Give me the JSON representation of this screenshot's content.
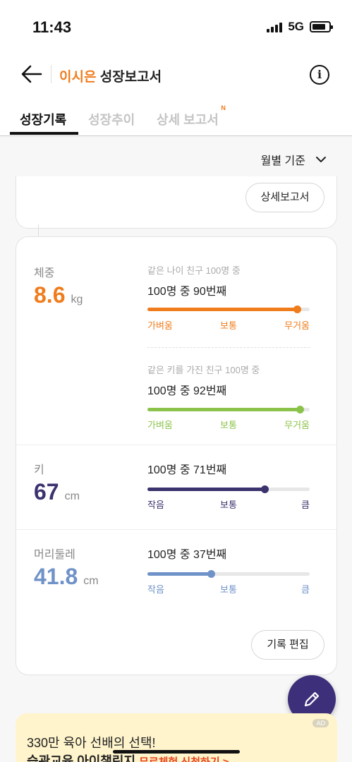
{
  "status_bar": {
    "time": "11:43",
    "network": "5G"
  },
  "header": {
    "child_name": "이시은",
    "title_rest": "성장보고서",
    "info_icon": "info-icon",
    "back_icon": "back-arrow-icon"
  },
  "tabs": [
    {
      "label": "성장기록",
      "active": true
    },
    {
      "label": "성장추이",
      "active": false
    },
    {
      "label": "상세 보고서",
      "active": false,
      "badge": "N"
    }
  ],
  "sort": {
    "label": "월별 기준"
  },
  "report_button": "상세보고서",
  "weight": {
    "label": "체중",
    "value": "8.6",
    "unit": "kg",
    "color": "#f07c1c",
    "age_comparison": {
      "caption": "같은 나이 친구 100명 중",
      "rank": "100명 중 90번째",
      "percentile": 0.92,
      "color": "#f07c1c",
      "scale": [
        "가벼움",
        "보통",
        "무거움"
      ]
    },
    "height_comparison": {
      "caption": "같은 키를 가진 친구 100명 중",
      "rank": "100명 중 92번째",
      "percentile": 0.94,
      "color": "#8bc34a",
      "scale": [
        "가벼움",
        "보통",
        "무거움"
      ]
    }
  },
  "height": {
    "label": "키",
    "value": "67",
    "unit": "cm",
    "color": "#3a336e",
    "rank": "100명 중 71번째",
    "percentile": 0.72,
    "scale": [
      "작음",
      "보통",
      "큼"
    ]
  },
  "head": {
    "label": "머리둘레",
    "value": "41.8",
    "unit": "cm",
    "color": "#6f92c9",
    "rank": "100명 중 37번째",
    "percentile": 0.39,
    "scale": [
      "작음",
      "보통",
      "큼"
    ]
  },
  "edit_button": "기록 편집",
  "ad": {
    "line1": "330만 육아 선배의 선택!",
    "line2": "습관교육 아이챌린지",
    "cta": "무료체험 신청하기 >",
    "badge": "AD"
  }
}
